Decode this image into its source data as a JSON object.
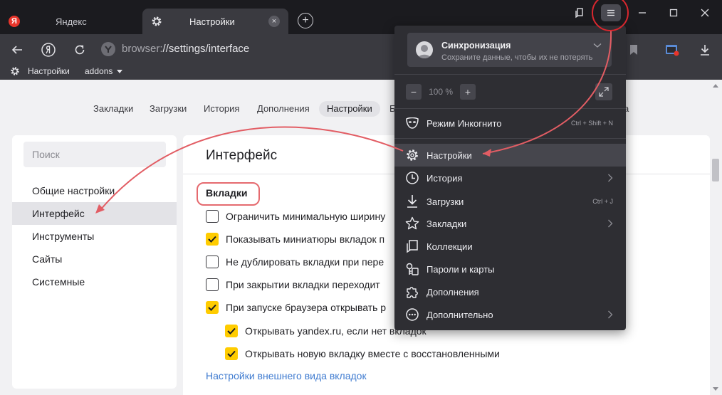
{
  "colors": {
    "accent": "#ffcc00",
    "annotation": "#e25d64",
    "link": "#3f7bd0"
  },
  "tabs": [
    {
      "title": "Яндекс",
      "icon": "yandex-logo-icon",
      "logo_letter": "Я"
    },
    {
      "title": "Настройки",
      "icon": "gear-icon",
      "close": "×"
    }
  ],
  "new_tab": "+",
  "url": {
    "scheme": "browser:",
    "path": "//settings/interface"
  },
  "bookmarks": [
    {
      "label": "Настройки"
    },
    {
      "label": "addons"
    }
  ],
  "topnav": [
    "Закладки",
    "Загрузки",
    "История",
    "Дополнения",
    "Настройки",
    "Б",
    "а"
  ],
  "sidebar": {
    "search_placeholder": "Поиск",
    "items": [
      "Общие настройки",
      "Интерфейс",
      "Инструменты",
      "Сайты",
      "Системные"
    ]
  },
  "content": {
    "title": "Интерфейс",
    "section": "Вкладки",
    "options": [
      {
        "label": "Ограничить минимальную ширину",
        "checked": false
      },
      {
        "label": "Показывать миниатюры вкладок п",
        "checked": true
      },
      {
        "label": "Не дублировать вкладки при пере",
        "checked": false
      },
      {
        "label": "При закрытии вкладки переходит",
        "checked": false
      },
      {
        "label": "При запуске браузера открывать р",
        "checked": true
      },
      {
        "label": "Открывать yandex.ru, если нет вкладок",
        "checked": true
      },
      {
        "label": "Открывать новую вкладку вместе с восстановленными",
        "checked": true
      }
    ],
    "link": "Настройки внешнего вида вкладок"
  },
  "menu": {
    "sync": {
      "title": "Синхронизация",
      "subtitle": "Сохраните данные, чтобы их не потерять"
    },
    "zoom": {
      "minus": "−",
      "value": "100 %",
      "plus": "+"
    },
    "items": [
      {
        "label": "Режим Инкогнито",
        "shortcut": "Ctrl + Shift + N",
        "icon": "incognito-mask-icon"
      },
      {
        "label": "Настройки",
        "shortcut": "",
        "icon": "gear-icon"
      },
      {
        "label": "История",
        "shortcut": "",
        "icon": "clock-icon",
        "submenu": true
      },
      {
        "label": "Загрузки",
        "shortcut": "Ctrl + J",
        "icon": "download-icon"
      },
      {
        "label": "Закладки",
        "shortcut": "",
        "icon": "star-icon",
        "submenu": true
      },
      {
        "label": "Коллекции",
        "shortcut": "",
        "icon": "collections-icon"
      },
      {
        "label": "Пароли и карты",
        "shortcut": "",
        "icon": "key-card-icon"
      },
      {
        "label": "Дополнения",
        "shortcut": "",
        "icon": "puzzle-icon"
      },
      {
        "label": "Дополнительно",
        "shortcut": "",
        "icon": "more-dots-icon",
        "submenu": true
      }
    ]
  }
}
